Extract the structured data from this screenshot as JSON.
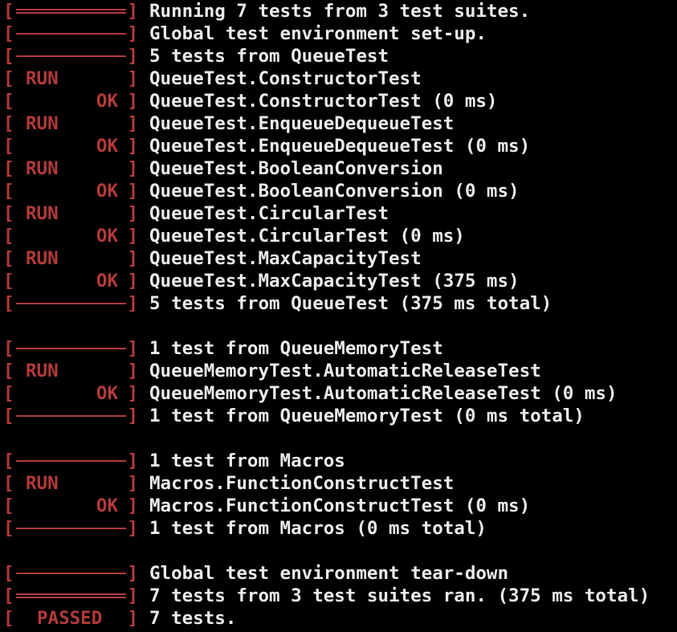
{
  "colors": {
    "background": "#000000",
    "text": "#ecebec",
    "status": "#b33a3a"
  },
  "status_labels": {
    "run": "RUN",
    "ok": "OK",
    "passed": "PASSED"
  },
  "lines": [
    {
      "type": "dbar",
      "text": "Running 7 tests from 3 test suites."
    },
    {
      "type": "bar",
      "text": "Global test environment set-up."
    },
    {
      "type": "bar",
      "text": "5 tests from QueueTest"
    },
    {
      "type": "run",
      "text": "QueueTest.ConstructorTest"
    },
    {
      "type": "ok",
      "text": "QueueTest.ConstructorTest (0 ms)"
    },
    {
      "type": "run",
      "text": "QueueTest.EnqueueDequeueTest"
    },
    {
      "type": "ok",
      "text": "QueueTest.EnqueueDequeueTest (0 ms)"
    },
    {
      "type": "run",
      "text": "QueueTest.BooleanConversion"
    },
    {
      "type": "ok",
      "text": "QueueTest.BooleanConversion (0 ms)"
    },
    {
      "type": "run",
      "text": "QueueTest.CircularTest"
    },
    {
      "type": "ok",
      "text": "QueueTest.CircularTest (0 ms)"
    },
    {
      "type": "run",
      "text": "QueueTest.MaxCapacityTest"
    },
    {
      "type": "ok",
      "text": "QueueTest.MaxCapacityTest (375 ms)"
    },
    {
      "type": "bar",
      "text": "5 tests from QueueTest (375 ms total)"
    },
    {
      "type": "blank",
      "text": ""
    },
    {
      "type": "bar",
      "text": "1 test from QueueMemoryTest"
    },
    {
      "type": "run",
      "text": "QueueMemoryTest.AutomaticReleaseTest"
    },
    {
      "type": "ok",
      "text": "QueueMemoryTest.AutomaticReleaseTest (0 ms)"
    },
    {
      "type": "bar",
      "text": "1 test from QueueMemoryTest (0 ms total)"
    },
    {
      "type": "blank",
      "text": ""
    },
    {
      "type": "bar",
      "text": "1 test from Macros"
    },
    {
      "type": "run",
      "text": "Macros.FunctionConstructTest"
    },
    {
      "type": "ok",
      "text": "Macros.FunctionConstructTest (0 ms)"
    },
    {
      "type": "bar",
      "text": "1 test from Macros (0 ms total)"
    },
    {
      "type": "blank",
      "text": ""
    },
    {
      "type": "bar",
      "text": "Global test environment tear-down"
    },
    {
      "type": "dbar",
      "text": "7 tests from 3 test suites ran. (375 ms total)"
    },
    {
      "type": "passed",
      "text": "7 tests."
    }
  ]
}
